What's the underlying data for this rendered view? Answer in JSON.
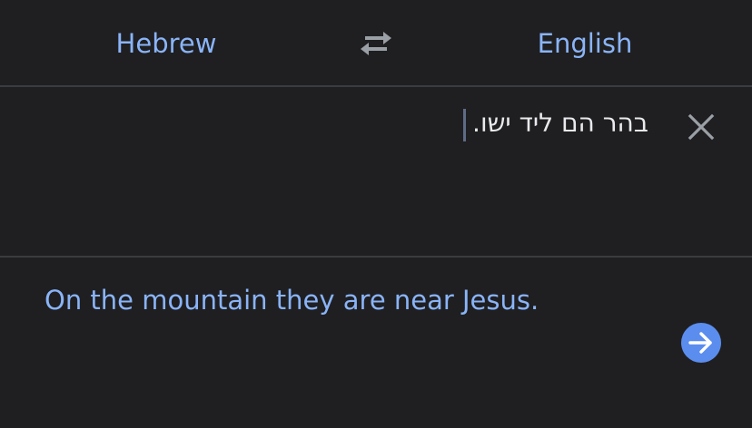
{
  "languages": {
    "source": "Hebrew",
    "target": "English"
  },
  "input": {
    "text": "בהר הם ליד ישו."
  },
  "output": {
    "text": "On the mountain they are near Jesus."
  },
  "icons": {
    "swap": "swap-arrows-icon",
    "clear": "close-icon",
    "submit": "arrow-right-icon"
  },
  "colors": {
    "background": "#1f1f21",
    "accent": "#8ab4f8",
    "button": "#5b8def",
    "text": "#e8eaed"
  }
}
